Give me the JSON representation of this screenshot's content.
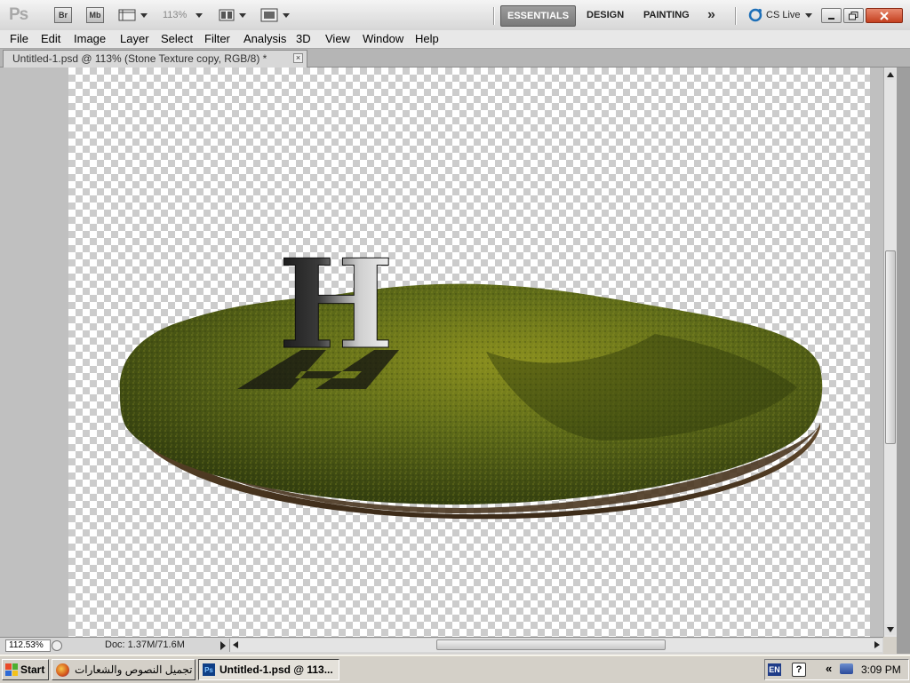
{
  "appbar": {
    "logo": "Ps",
    "bridge_label": "Br",
    "minibridge_label": "Mb",
    "zoom_value": "113%",
    "workspaces": [
      "ESSENTIALS",
      "DESIGN",
      "PAINTING"
    ],
    "active_workspace": "ESSENTIALS",
    "more_label": "»",
    "cs_live_label": "CS Live"
  },
  "menubar": {
    "items": [
      "File",
      "Edit",
      "Image",
      "Layer",
      "Select",
      "Filter",
      "Analysis",
      "3D",
      "View",
      "Window",
      "Help"
    ]
  },
  "document": {
    "tab_title": "Untitled-1.psd @ 113% (Stone Texture copy, RGB/8) *",
    "canvas_letter": "H"
  },
  "statusbar": {
    "zoom": "112.53%",
    "doc_size": "Doc: 1.37M/71.6M"
  },
  "taskbar": {
    "start_label": "Start",
    "task1_label": "تجميل النصوص والشعارات ...",
    "task2_label": "Untitled-1.psd @ 113...",
    "lang": "EN",
    "clock": "3:09 PM"
  },
  "colors": {
    "grass": "#5a6a1c",
    "soil": "#5a4128",
    "active_workspace": "#8a8a8a",
    "close_button": "#c4401f"
  },
  "icons": {
    "bridge": "bridge-icon",
    "minibridge": "minibridge-icon",
    "view_extras": "view-extras-icon",
    "arrange": "arrange-documents-icon",
    "screen_mode": "screen-mode-icon",
    "cs_live": "cs-live-icon"
  }
}
